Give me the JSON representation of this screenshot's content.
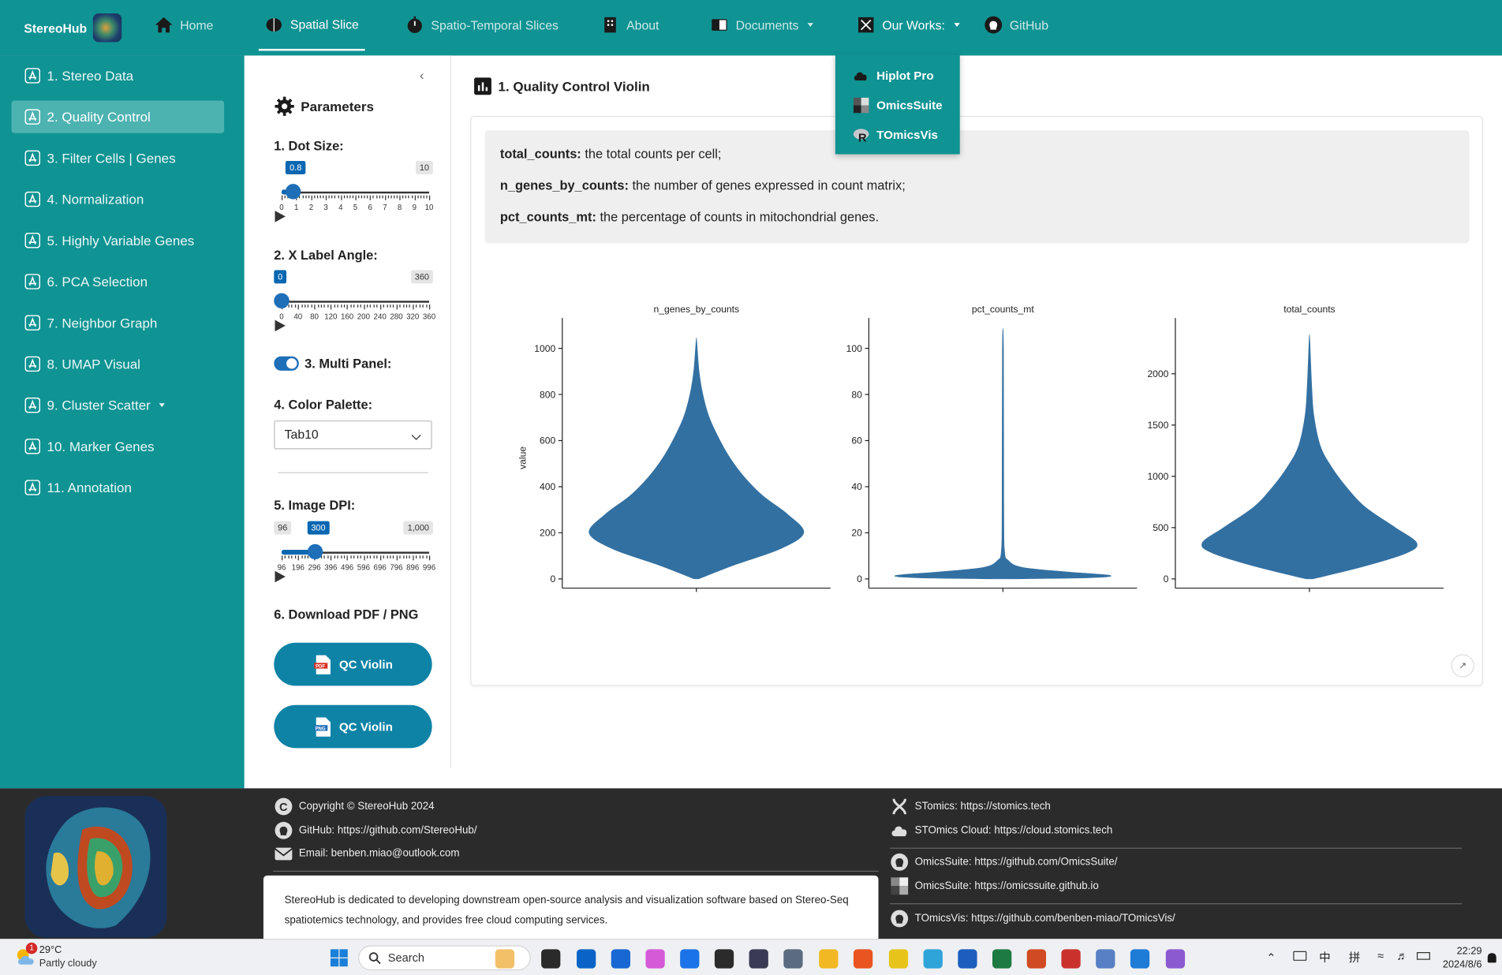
{
  "brand": {
    "name": "StereoHub"
  },
  "nav": {
    "home": "Home",
    "spatial_slice": "Spatial Slice",
    "spatio_temporal": "Spatio-Temporal Slices",
    "about": "About",
    "documents": "Documents",
    "our_works": "Our Works:",
    "github": "GitHub"
  },
  "dropdown": {
    "items": [
      "Hiplot Pro",
      "OmicsSuite",
      "TOmicsVis"
    ]
  },
  "sidebar": {
    "items": [
      {
        "label": "1. Stereo Data"
      },
      {
        "label": "2. Quality Control"
      },
      {
        "label": "3. Filter Cells | Genes"
      },
      {
        "label": "4. Normalization"
      },
      {
        "label": "5. Highly Variable Genes"
      },
      {
        "label": "6. PCA Selection"
      },
      {
        "label": "7. Neighbor Graph"
      },
      {
        "label": "8. UMAP Visual"
      },
      {
        "label": "9. Cluster Scatter"
      },
      {
        "label": "10. Marker Genes"
      },
      {
        "label": "11. Annotation"
      }
    ]
  },
  "params": {
    "title": "Parameters",
    "dot_size": {
      "label": "1. Dot Size:",
      "value": "0.8",
      "max": "10",
      "ticks": [
        "0",
        "1",
        "2",
        "3",
        "4",
        "5",
        "6",
        "7",
        "8",
        "9",
        "10"
      ],
      "fraction": 0.08
    },
    "x_angle": {
      "label": "2. X Label Angle:",
      "value": "0",
      "max": "360",
      "ticks": [
        "0",
        "40",
        "80",
        "120",
        "160",
        "200",
        "240",
        "280",
        "320",
        "360"
      ],
      "fraction": 0
    },
    "multi_panel": {
      "label": "3. Multi Panel:",
      "on": true
    },
    "palette": {
      "label": "4. Color Palette:",
      "value": "Tab10"
    },
    "dpi": {
      "label": "5. Image DPI:",
      "min": "96",
      "value": "300",
      "max": "1,000",
      "ticks": [
        "96",
        "196",
        "296",
        "396",
        "496",
        "596",
        "696",
        "796",
        "896",
        "996"
      ],
      "fraction": 0.2257
    },
    "download": {
      "label": "6. Download PDF / PNG",
      "pdf_button": "QC Violin",
      "png_button": "QC Violin"
    }
  },
  "main": {
    "title": "1. Quality Control Violin",
    "desc": [
      {
        "key": "total_counts:",
        "text": " the total counts per cell;"
      },
      {
        "key": "n_genes_by_counts:",
        "text": " the number of genes expressed in count matrix;"
      },
      {
        "key": "pct_counts_mt:",
        "text": " the percentage of counts in mitochondrial genes."
      }
    ]
  },
  "chart_data": [
    {
      "type": "violin",
      "title": "n_genes_by_counts",
      "ylabel": "value",
      "yticks": [
        0,
        200,
        400,
        600,
        800,
        1000
      ],
      "ylim": [
        -40,
        1090
      ],
      "color": "#3370a2",
      "profile": [
        [
          0,
          0.02
        ],
        [
          60,
          0.35
        ],
        [
          130,
          0.78
        ],
        [
          200,
          1.0
        ],
        [
          280,
          0.85
        ],
        [
          360,
          0.62
        ],
        [
          440,
          0.45
        ],
        [
          520,
          0.32
        ],
        [
          600,
          0.22
        ],
        [
          700,
          0.12
        ],
        [
          800,
          0.06
        ],
        [
          900,
          0.025
        ],
        [
          1030,
          0.003
        ]
      ]
    },
    {
      "type": "violin",
      "title": "pct_counts_mt",
      "ylabel": "",
      "yticks": [
        0,
        20,
        40,
        60,
        80,
        100
      ],
      "ylim": [
        -4,
        109
      ],
      "color": "#3370a2",
      "profile": [
        [
          0,
          0.02
        ],
        [
          0.5,
          0.8
        ],
        [
          1.5,
          1.0
        ],
        [
          3,
          0.6
        ],
        [
          5,
          0.18
        ],
        [
          8,
          0.05
        ],
        [
          12,
          0.015
        ],
        [
          30,
          0.008
        ],
        [
          100,
          0.005
        ]
      ]
    },
    {
      "type": "violin",
      "title": "total_counts",
      "ylabel": "",
      "yticks": [
        0,
        500,
        1000,
        1500,
        2000
      ],
      "ylim": [
        -90,
        2450
      ],
      "color": "#3370a2",
      "profile": [
        [
          0,
          0.03
        ],
        [
          120,
          0.5
        ],
        [
          250,
          0.9
        ],
        [
          350,
          1.0
        ],
        [
          500,
          0.8
        ],
        [
          700,
          0.52
        ],
        [
          900,
          0.34
        ],
        [
          1100,
          0.2
        ],
        [
          1300,
          0.1
        ],
        [
          1600,
          0.04
        ],
        [
          1900,
          0.02
        ],
        [
          2330,
          0.003
        ]
      ]
    }
  ],
  "footer": {
    "copyright": "Copyright © StereoHub 2024",
    "github": "GitHub: https://github.com/StereoHub/",
    "email": "Email: benben.miao@outlook.com",
    "about": "StereoHub is dedicated to developing downstream open-source analysis and visualization software based on Stereo-Seq spatiotemics technology, and provides free cloud computing services.",
    "links": [
      "STomics: https://stomics.tech",
      "STOmics Cloud: https://cloud.stomics.tech",
      "OmicsSuite: https://github.com/OmicsSuite/",
      "OmicsSuite: https://omicssuite.github.io",
      "TOmicsVis: https://github.com/benben-miao/TOmicsVis/"
    ]
  },
  "taskbar": {
    "weather_temp": "29°C",
    "weather_desc": "Partly cloudy",
    "weather_badge": "1",
    "search": "Search",
    "ime1": "中",
    "ime2": "拼",
    "time": "22:29",
    "date": "2024/8/6"
  },
  "colors": {
    "teal": "#109393",
    "accent_blue": "#0a67b1",
    "button": "#0f83a6",
    "violin": "#3370a2"
  }
}
